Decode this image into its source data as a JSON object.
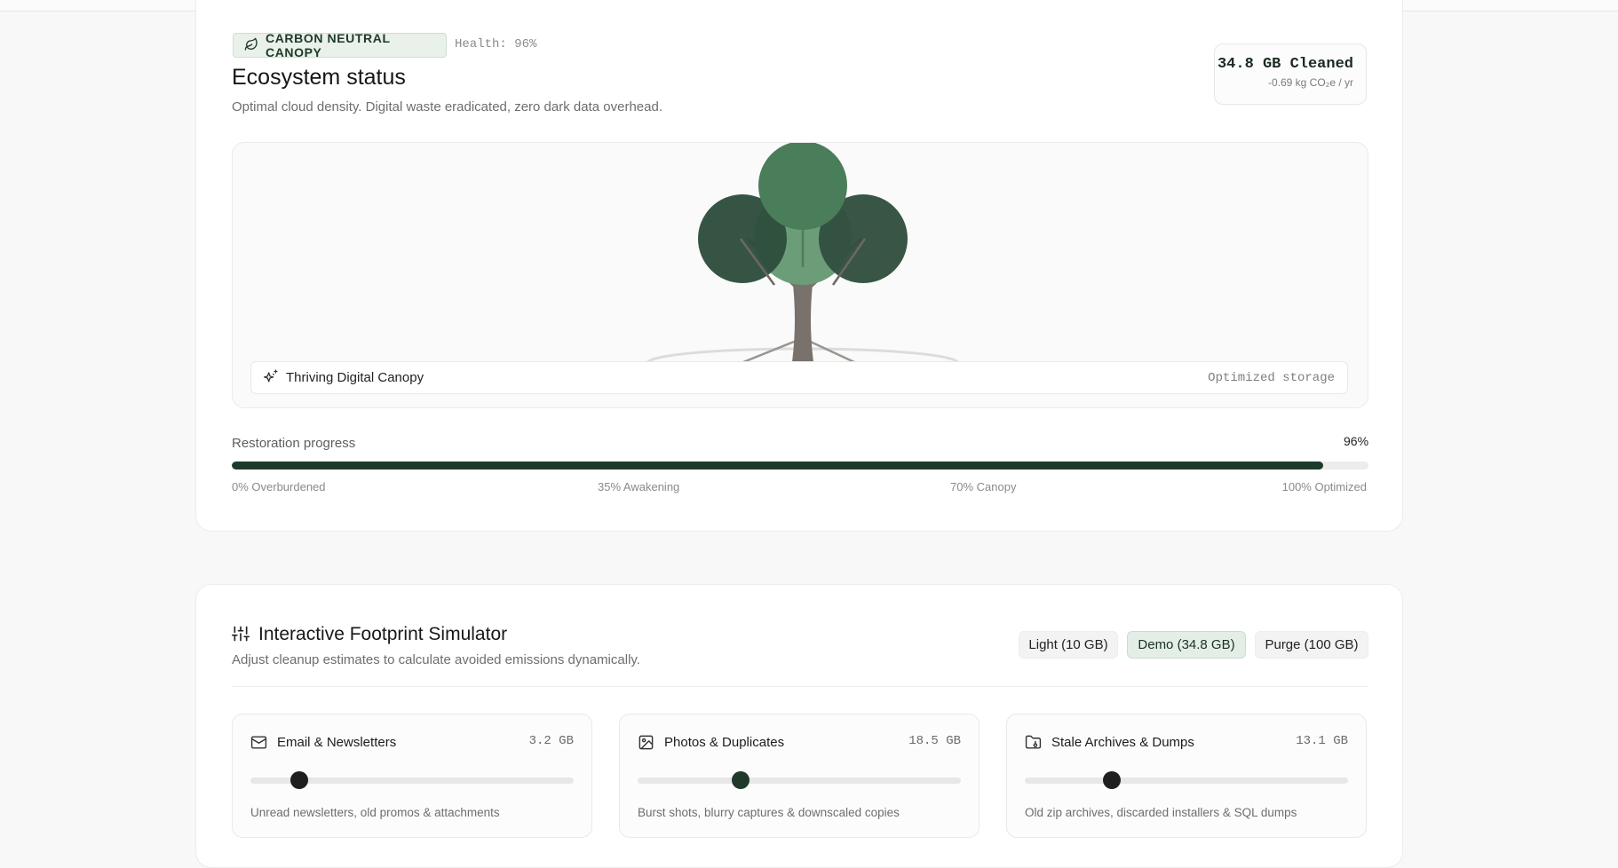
{
  "status": {
    "badge_label": "CARBON NEUTRAL CANOPY",
    "health": "Health: 96%",
    "title": "Ecosystem status",
    "subtitle": "Optimal cloud density. Digital waste eradicated, zero dark data overhead.",
    "cleaned_amount": "34.8 GB Cleaned",
    "cleaned_co2": "-0.69 kg CO₂e / yr",
    "scene_caption": "Thriving Digital Canopy",
    "scene_state": "Optimized storage",
    "progress_label": "Restoration progress",
    "progress_value": "96%",
    "progress_fraction": 0.96,
    "milestones": [
      "0% Overburdened",
      "35% Awakening",
      "70% Canopy",
      "100% Optimized"
    ]
  },
  "simulator": {
    "title": "Interactive Footprint Simulator",
    "subtitle": "Adjust cleanup estimates to calculate avoided emissions dynamically.",
    "presets": [
      {
        "label": "Light (10 GB)",
        "active": false
      },
      {
        "label": "Demo (34.8 GB)",
        "active": true
      },
      {
        "label": "Purge (100 GB)",
        "active": false
      }
    ],
    "categories": [
      {
        "name": "Email & Newsletters",
        "size": "3.2 GB",
        "level": 0.15,
        "desc": "Unread newsletters, old promos & attachments",
        "icon": "mail-icon"
      },
      {
        "name": "Photos & Duplicates",
        "size": "18.5 GB",
        "level": 0.32,
        "desc": "Burst shots, blurry captures & downscaled copies",
        "icon": "image-icon"
      },
      {
        "name": "Stale Archives & Dumps",
        "size": "13.1 GB",
        "level": 0.27,
        "desc": "Old zip archives, discarded installers & SQL dumps",
        "icon": "folder-archive-icon"
      }
    ]
  },
  "colors": {
    "accent": "#1d3b2a",
    "thumb_dark": "#1f1f1f",
    "thumb_green": "#1f3a2b"
  }
}
